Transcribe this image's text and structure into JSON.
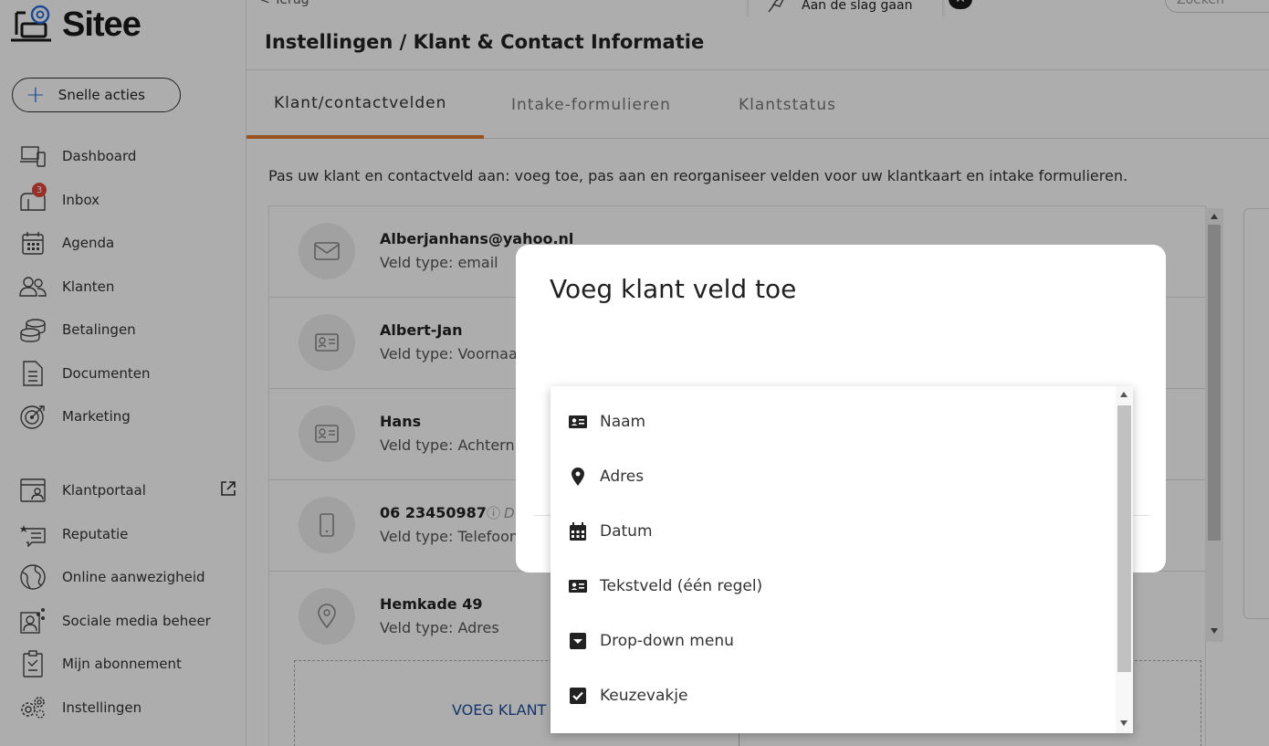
{
  "app": {
    "name": "Sitee"
  },
  "sidebar": {
    "quick_actions": "Snelle acties",
    "items": [
      {
        "label": "Dashboard",
        "icon": "laptop-icon"
      },
      {
        "label": "Inbox",
        "icon": "inbox-icon",
        "badge": "3"
      },
      {
        "label": "Agenda",
        "icon": "calendar-icon"
      },
      {
        "label": "Klanten",
        "icon": "users-icon"
      },
      {
        "label": "Betalingen",
        "icon": "coins-icon"
      },
      {
        "label": "Documenten",
        "icon": "document-icon"
      },
      {
        "label": "Marketing",
        "icon": "target-icon"
      },
      {
        "label": "Klantportaal",
        "icon": "portal-icon"
      },
      {
        "label": "Reputatie",
        "icon": "review-icon"
      },
      {
        "label": "Online aanwezigheid",
        "icon": "globe-icon"
      },
      {
        "label": "Sociale media beheer",
        "icon": "social-icon"
      },
      {
        "label": "Mijn abonnement",
        "icon": "clipboard-icon"
      },
      {
        "label": "Instellingen",
        "icon": "gears-icon"
      }
    ]
  },
  "topbar": {
    "back": "< Terug",
    "toast": "Aan de slag gaan",
    "search_placeholder": "Zoeken"
  },
  "header": {
    "title": "Instellingen / Klant & Contact Informatie"
  },
  "tabs": [
    {
      "label": "Klant/contactvelden",
      "active": true
    },
    {
      "label": "Intake-formulieren",
      "active": false
    },
    {
      "label": "Klantstatus",
      "active": false
    }
  ],
  "main": {
    "description": "Pas uw klant en contactveld aan: voeg toe, pas aan en reorganiseer velden voor uw klantkaart en intake formulieren.",
    "fields": [
      {
        "title": "Alberjanhans@yahoo.nl",
        "type": "Veld type: email",
        "icon": "envelope-icon"
      },
      {
        "title": "Albert-Jan",
        "type": "Veld type: Voornaa",
        "icon": "id-card-icon"
      },
      {
        "title": "Hans",
        "type": "Veld type: Achtern",
        "icon": "id-card-icon"
      },
      {
        "title": "06 23450987",
        "type": "Veld type: Telefoon",
        "icon": "phone-icon",
        "note": "D"
      },
      {
        "title": "Hemkade 49",
        "type": "Veld type: Adres",
        "icon": "location-icon"
      }
    ],
    "add_button": "VOEG KLANT VE"
  },
  "modal": {
    "title": "Voeg klant veld toe",
    "options": [
      {
        "label": "Naam",
        "icon": "id-card-icon"
      },
      {
        "label": "Adres",
        "icon": "location-pin-icon"
      },
      {
        "label": "Datum",
        "icon": "calendar-icon"
      },
      {
        "label": "Tekstveld (één regel)",
        "icon": "id-card-icon"
      },
      {
        "label": "Drop-down menu",
        "icon": "dropdown-icon"
      },
      {
        "label": "Keuzevakje",
        "icon": "checkbox-icon"
      }
    ]
  },
  "colors": {
    "accent": "#e07b2e",
    "brand": "#2a6fdb",
    "link": "#1f4f9e"
  }
}
